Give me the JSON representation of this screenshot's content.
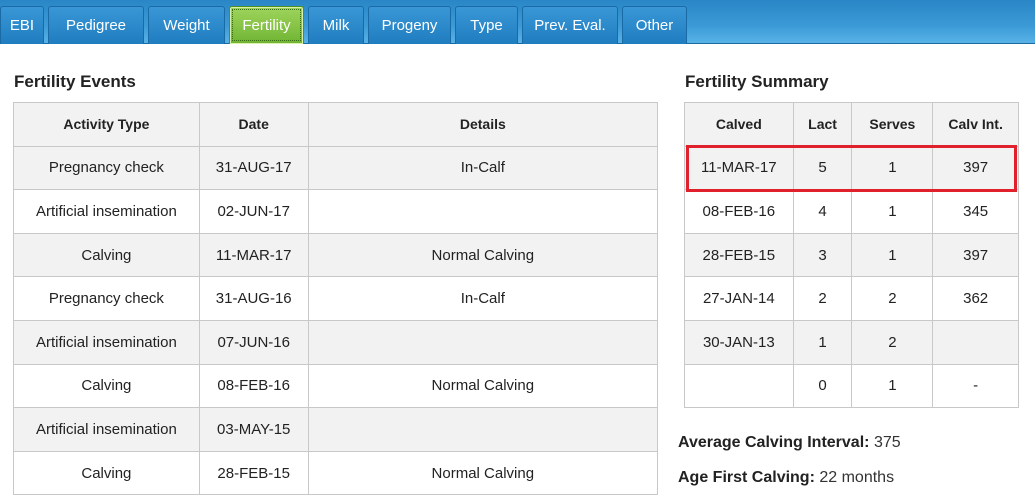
{
  "tabs": [
    {
      "label": "EBI"
    },
    {
      "label": "Pedigree"
    },
    {
      "label": "Weight"
    },
    {
      "label": "Fertility",
      "active": true
    },
    {
      "label": "Milk"
    },
    {
      "label": "Progeny"
    },
    {
      "label": "Type"
    },
    {
      "label": "Prev. Eval."
    },
    {
      "label": "Other"
    }
  ],
  "events": {
    "title": "Fertility Events",
    "columns": [
      "Activity Type",
      "Date",
      "Details"
    ],
    "rows": [
      [
        "Pregnancy check",
        "31-AUG-17",
        "In-Calf"
      ],
      [
        "Artificial insemination",
        "02-JUN-17",
        ""
      ],
      [
        "Calving",
        "11-MAR-17",
        "Normal Calving"
      ],
      [
        "Pregnancy check",
        "31-AUG-16",
        "In-Calf"
      ],
      [
        "Artificial insemination",
        "07-JUN-16",
        ""
      ],
      [
        "Calving",
        "08-FEB-16",
        "Normal Calving"
      ],
      [
        "Artificial insemination",
        "03-MAY-15",
        ""
      ],
      [
        "Calving",
        "28-FEB-15",
        "Normal Calving"
      ]
    ]
  },
  "summary": {
    "title": "Fertility Summary",
    "columns": [
      "Calved",
      "Lact",
      "Serves",
      "Calv Int."
    ],
    "rows": [
      [
        "11-MAR-17",
        "5",
        "1",
        "397"
      ],
      [
        "08-FEB-16",
        "4",
        "1",
        "345"
      ],
      [
        "28-FEB-15",
        "3",
        "1",
        "397"
      ],
      [
        "27-JAN-14",
        "2",
        "2",
        "362"
      ],
      [
        "30-JAN-13",
        "1",
        "2",
        ""
      ],
      [
        "",
        "0",
        "1",
        "-"
      ]
    ],
    "avg_calving_interval_label": "Average Calving Interval:",
    "avg_calving_interval_value": "375",
    "age_first_calving_label": "Age First Calving:",
    "age_first_calving_value": "22 months"
  },
  "colors": {
    "tab_bar": "#2a86c6",
    "active_tab": "#8cc94a",
    "highlight": "#e0202a"
  }
}
